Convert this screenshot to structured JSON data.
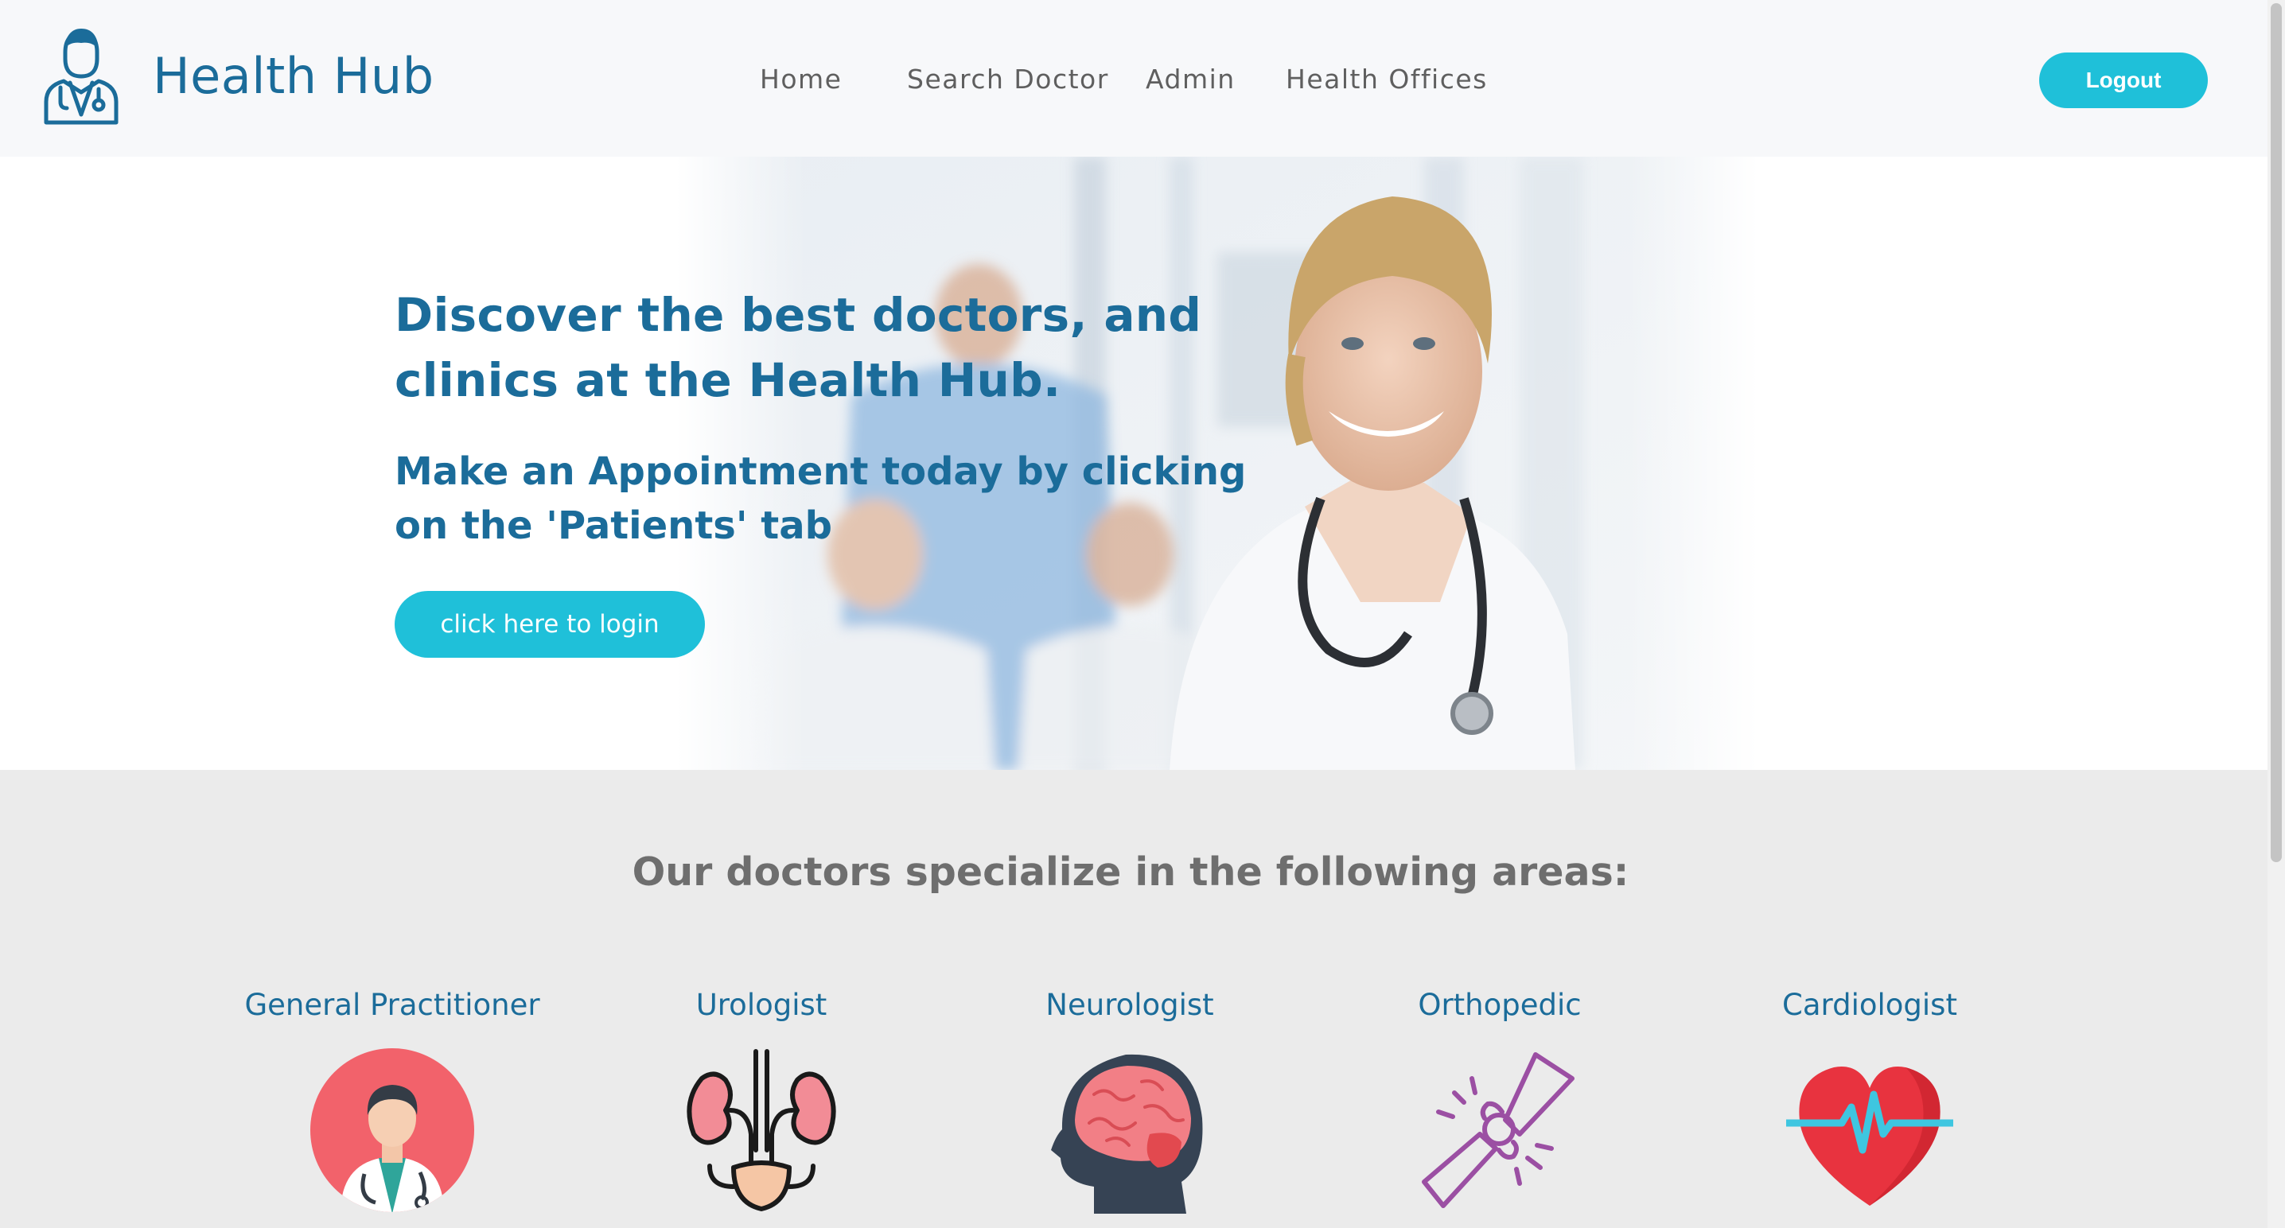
{
  "brand": {
    "name": "Health Hub"
  },
  "nav": {
    "items": [
      {
        "label": "Home"
      },
      {
        "label": "Search Doctor"
      },
      {
        "label": "Admin"
      },
      {
        "label": "Health Offices"
      }
    ],
    "logout_label": "Logout"
  },
  "hero": {
    "heading_line1": "Discover the best doctors, and",
    "heading_line2": "clinics at the Health Hub.",
    "sub_line1": "Make an Appointment today by clicking",
    "sub_line2": "on the 'Patients' tab",
    "login_label": "click here to login"
  },
  "specialties": {
    "title": "Our doctors specialize in the following areas:",
    "items": [
      {
        "label": "General Practitioner",
        "icon": "doctor-avatar-icon"
      },
      {
        "label": "Urologist",
        "icon": "kidneys-icon"
      },
      {
        "label": "Neurologist",
        "icon": "brain-head-icon"
      },
      {
        "label": "Orthopedic",
        "icon": "bone-joint-icon"
      },
      {
        "label": "Cardiologist",
        "icon": "heartbeat-icon"
      }
    ]
  },
  "colors": {
    "brand_blue": "#1b6c9a",
    "accent_cyan": "#1fc0d9",
    "nav_text": "#5f5f5f",
    "section_bg": "#ebebeb"
  }
}
